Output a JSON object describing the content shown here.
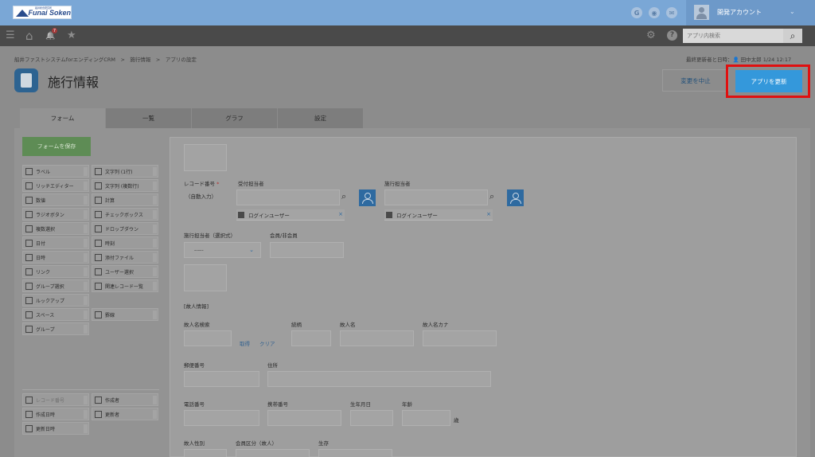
{
  "header": {
    "logo_small": "船井総合研究所",
    "logo_text": "Funai Soken",
    "icons": [
      {
        "name": "garoon-icon",
        "glyph": "G"
      },
      {
        "name": "office-icon",
        "glyph": "◉"
      },
      {
        "name": "mail-icon",
        "glyph": "✉"
      }
    ],
    "account_name": "開発アカウント",
    "account_chevron": "⌄"
  },
  "subbar": {
    "menu_glyph": "☰",
    "home_glyph": "⌂",
    "bell_glyph": "🔔",
    "bell_count": "7",
    "star_glyph": "★",
    "gear_glyph": "⚙",
    "help_glyph": "?",
    "search_placeholder": "アプリ内検索",
    "search_glyph": "⌕"
  },
  "page": {
    "breadcrumb": "船井ファストシステムforエンディングCRM　>　施行情報　>　アプリの設定",
    "last_updated": "最終更新者と日時：👤 田中太郎  1/24 12:17",
    "title": "施行情報",
    "cancel_label": "変更を中止",
    "update_label": "アプリを更新"
  },
  "tabs": [
    {
      "label": "フォーム",
      "active": true
    },
    {
      "label": "一覧",
      "active": false
    },
    {
      "label": "グラフ",
      "active": false
    },
    {
      "label": "設定",
      "active": false
    }
  ],
  "palette": {
    "save_label": "フォームを保存",
    "items": [
      {
        "label": "ラベル",
        "icon": "label-icon"
      },
      {
        "label": "文字列 (1行)",
        "icon": "text-single-icon"
      },
      {
        "label": "リッチエディター",
        "icon": "rich-editor-icon"
      },
      {
        "label": "文字列 (複数行)",
        "icon": "text-multi-icon"
      },
      {
        "label": "数値",
        "icon": "number-icon"
      },
      {
        "label": "計算",
        "icon": "calc-icon"
      },
      {
        "label": "ラジオボタン",
        "icon": "radio-icon"
      },
      {
        "label": "チェックボックス",
        "icon": "checkbox-icon"
      },
      {
        "label": "複数選択",
        "icon": "multi-select-icon"
      },
      {
        "label": "ドロップダウン",
        "icon": "dropdown-icon"
      },
      {
        "label": "日付",
        "icon": "date-icon"
      },
      {
        "label": "時刻",
        "icon": "time-icon"
      },
      {
        "label": "日時",
        "icon": "datetime-icon"
      },
      {
        "label": "添付ファイル",
        "icon": "attachment-icon"
      },
      {
        "label": "リンク",
        "icon": "link-icon"
      },
      {
        "label": "ユーザー選択",
        "icon": "user-select-icon"
      },
      {
        "label": "グループ選択",
        "icon": "group-select-icon"
      },
      {
        "label": "関連レコード一覧",
        "icon": "related-records-icon"
      },
      {
        "label": "ルックアップ",
        "icon": "lookup-icon"
      },
      {
        "label": "スペース",
        "icon": "space-icon"
      },
      {
        "label": "罫線",
        "icon": "border-icon"
      },
      {
        "label": "グループ",
        "icon": "group-icon"
      },
      {
        "label": "レコード番号",
        "icon": "record-number-icon"
      },
      {
        "label": "作成者",
        "icon": "creator-icon"
      },
      {
        "label": "作成日時",
        "icon": "created-at-icon"
      },
      {
        "label": "更新者",
        "icon": "updater-icon"
      },
      {
        "label": "更新日時",
        "icon": "updated-at-icon"
      }
    ]
  },
  "form": {
    "record_number_label": "レコード番号",
    "required_mark": "*",
    "auto_input": "（自動入力）",
    "reception_label": "受付担当者",
    "execution_label": "施行担当者",
    "login_user": "ログインユーザー",
    "chip_remove": "×",
    "execution_select_label": "施行担当者（選択式）",
    "select_placeholder": "-----",
    "member_label": "会員/非会員",
    "deceased_section": "[故人情報]",
    "deceased_search_label": "故人名検索",
    "fetch_link": "取得",
    "clear_link": "クリア",
    "title_label": "続柄",
    "name_label": "故人名",
    "name_kana_label": "故人名カナ",
    "postal_label": "郵便番号",
    "address_label": "住所",
    "phone_label": "電話番号",
    "mobile_label": "携帯番号",
    "birthday_label": "生年月日",
    "age_label": "年齢",
    "age_unit": "歳",
    "gender_label": "故人性別",
    "member_type_label": "会員区分（故人）",
    "alive_label": "生存"
  }
}
